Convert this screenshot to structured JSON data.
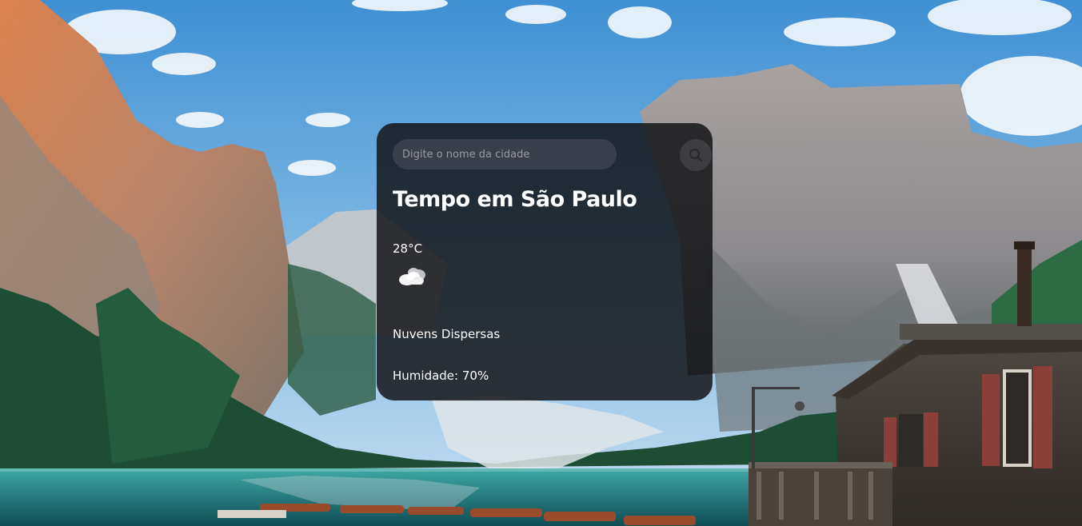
{
  "search": {
    "placeholder": "Digite o nome da cidade",
    "value": ""
  },
  "weather": {
    "title": "Tempo em São Paulo",
    "temperature": "28°C",
    "icon": "scattered-clouds-icon",
    "description": "Nuvens Dispersas",
    "humidity": "Humidade: 70%"
  },
  "colors": {
    "card_background": "#121214",
    "text": "#ffffff",
    "input_background": "#4a4a50",
    "placeholder": "#9a9a9f"
  }
}
